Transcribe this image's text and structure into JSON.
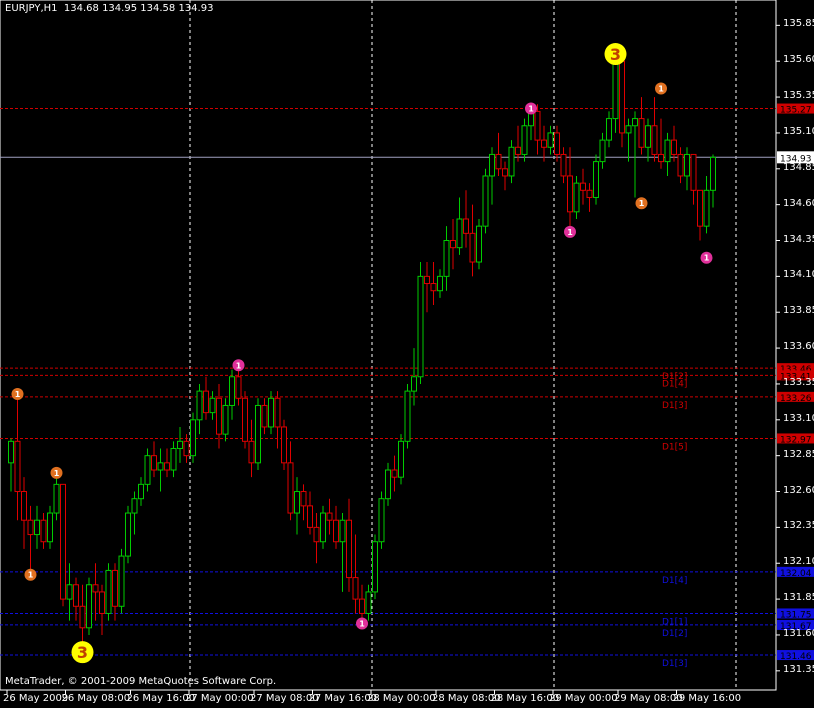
{
  "header": {
    "symbol": "EURJPY,H1",
    "open": "134.68",
    "high": "134.95",
    "low": "134.58",
    "close": "134.93"
  },
  "copyright": "MetaTrader, © 2001-2009 MetaQuotes Software Corp.",
  "colors": {
    "background": "#000000",
    "bull_candle": "#00cc00",
    "bear_candle": "#e00000",
    "grid": "#ffffff",
    "resistance": "#d00000",
    "support": "#1010e0",
    "current_price_line": "#a0a0c0",
    "marker_magenta": "#e0309a",
    "marker_orange": "#e07020",
    "marker_yellow": "#ffff00"
  },
  "chart_data": {
    "type": "candlestick",
    "title": "EURJPY,H1",
    "ylim": [
      131.3,
      135.95
    ],
    "xlim": [
      0,
      115
    ],
    "y_ticks": [
      "135.85",
      "135.60",
      "135.35",
      "135.10",
      "134.85",
      "134.60",
      "134.35",
      "134.10",
      "133.85",
      "133.60",
      "133.35",
      "133.10",
      "132.85",
      "132.60",
      "132.35",
      "132.10",
      "131.85",
      "131.60",
      "131.35"
    ],
    "x_ticks": [
      {
        "i": 0,
        "label": "26 May 2009"
      },
      {
        "i": 9,
        "label": "26 May 08:00"
      },
      {
        "i": 19,
        "label": "26 May 16:00"
      },
      {
        "i": 28,
        "label": "27 May 00:00"
      },
      {
        "i": 38,
        "label": "27 May 08:00"
      },
      {
        "i": 47,
        "label": "27 May 16:00"
      },
      {
        "i": 56,
        "label": "28 May 00:00"
      },
      {
        "i": 66,
        "label": "28 May 08:00"
      },
      {
        "i": 75,
        "label": "28 May 16:00"
      },
      {
        "i": 84,
        "label": "29 May 00:00"
      },
      {
        "i": 94,
        "label": "29 May 08:00"
      },
      {
        "i": 103,
        "label": "29 May 16:00"
      }
    ],
    "vertical_separators": [
      28,
      56,
      84,
      112
    ],
    "current_price": {
      "value": 134.93,
      "label": "134.93"
    },
    "price_tags": [
      {
        "value": 135.27,
        "label": "135.27",
        "style": "red"
      },
      {
        "value": 133.46,
        "label": "133.46",
        "style": "red"
      },
      {
        "value": 133.41,
        "label": "133.41",
        "style": "red"
      },
      {
        "value": 133.26,
        "label": "133.26",
        "style": "red"
      },
      {
        "value": 132.97,
        "label": "132.97",
        "style": "red"
      },
      {
        "value": 132.04,
        "label": "132.04",
        "style": "blue"
      },
      {
        "value": 131.75,
        "label": "131.75",
        "style": "blue"
      },
      {
        "value": 131.67,
        "label": "131.67",
        "style": "blue"
      },
      {
        "value": 131.46,
        "label": "131.46",
        "style": "blue"
      }
    ],
    "levels": [
      {
        "value": 135.27,
        "label": "",
        "style": "red"
      },
      {
        "value": 133.46,
        "label": "D1[2]",
        "style": "red"
      },
      {
        "value": 133.41,
        "label": "D1[4]",
        "style": "red"
      },
      {
        "value": 133.26,
        "label": "D1[3]",
        "style": "red"
      },
      {
        "value": 132.97,
        "label": "D1[5]",
        "style": "red"
      },
      {
        "value": 132.04,
        "label": "D1[4]",
        "style": "blue"
      },
      {
        "value": 131.75,
        "label": "D1[1]",
        "style": "blue"
      },
      {
        "value": 131.67,
        "label": "D1[2]",
        "style": "blue"
      },
      {
        "value": 131.46,
        "label": "D1[3]",
        "style": "blue"
      }
    ],
    "series": [
      {
        "name": "EURJPY,H1",
        "candles": [
          [
            132.8,
            132.97,
            132.6,
            132.95
          ],
          [
            132.95,
            133.25,
            132.4,
            132.6
          ],
          [
            132.6,
            132.7,
            132.2,
            132.4
          ],
          [
            132.4,
            132.5,
            132.0,
            132.3
          ],
          [
            132.3,
            132.5,
            132.2,
            132.4
          ],
          [
            132.4,
            132.45,
            132.2,
            132.25
          ],
          [
            132.25,
            132.5,
            132.2,
            132.45
          ],
          [
            132.45,
            132.7,
            132.4,
            132.65
          ],
          [
            132.65,
            132.65,
            131.8,
            131.85
          ],
          [
            131.85,
            132.1,
            131.7,
            131.95
          ],
          [
            131.95,
            132.0,
            131.7,
            131.8
          ],
          [
            131.8,
            131.95,
            131.5,
            131.65
          ],
          [
            131.65,
            132.0,
            131.6,
            131.95
          ],
          [
            131.95,
            132.1,
            131.7,
            131.9
          ],
          [
            131.9,
            131.95,
            131.6,
            131.75
          ],
          [
            131.75,
            132.1,
            131.7,
            132.05
          ],
          [
            132.05,
            132.1,
            131.7,
            131.8
          ],
          [
            131.8,
            132.2,
            131.75,
            132.15
          ],
          [
            132.15,
            132.5,
            132.1,
            132.45
          ],
          [
            132.45,
            132.6,
            132.3,
            132.55
          ],
          [
            132.55,
            132.7,
            132.5,
            132.65
          ],
          [
            132.65,
            132.9,
            132.6,
            132.85
          ],
          [
            132.85,
            132.95,
            132.7,
            132.75
          ],
          [
            132.75,
            132.9,
            132.6,
            132.8
          ],
          [
            132.8,
            132.9,
            132.7,
            132.75
          ],
          [
            132.75,
            132.95,
            132.7,
            132.9
          ],
          [
            132.9,
            133.05,
            132.8,
            132.95
          ],
          [
            132.95,
            133.0,
            132.8,
            132.85
          ],
          [
            132.85,
            133.15,
            132.8,
            133.1
          ],
          [
            133.1,
            133.35,
            133.0,
            133.3
          ],
          [
            133.3,
            133.4,
            133.1,
            133.15
          ],
          [
            133.15,
            133.3,
            133.1,
            133.25
          ],
          [
            133.25,
            133.35,
            132.9,
            133.0
          ],
          [
            133.0,
            133.25,
            132.95,
            133.2
          ],
          [
            133.2,
            133.45,
            133.1,
            133.4
          ],
          [
            133.4,
            133.5,
            133.2,
            133.25
          ],
          [
            133.25,
            133.3,
            132.9,
            132.95
          ],
          [
            132.95,
            133.1,
            132.7,
            132.8
          ],
          [
            132.8,
            133.25,
            132.75,
            133.2
          ],
          [
            133.2,
            133.25,
            133.0,
            133.05
          ],
          [
            133.05,
            133.3,
            133.0,
            133.25
          ],
          [
            133.25,
            133.3,
            132.9,
            133.05
          ],
          [
            133.05,
            133.1,
            132.75,
            132.8
          ],
          [
            132.8,
            132.95,
            132.4,
            132.45
          ],
          [
            132.45,
            132.7,
            132.3,
            132.6
          ],
          [
            132.6,
            132.65,
            132.4,
            132.5
          ],
          [
            132.5,
            132.6,
            132.3,
            132.35
          ],
          [
            132.35,
            132.45,
            132.1,
            132.25
          ],
          [
            132.25,
            132.5,
            132.2,
            132.45
          ],
          [
            132.45,
            132.55,
            132.3,
            132.4
          ],
          [
            132.4,
            132.5,
            132.2,
            132.25
          ],
          [
            132.25,
            132.45,
            131.9,
            132.4
          ],
          [
            132.4,
            132.55,
            131.9,
            132.0
          ],
          [
            132.0,
            132.3,
            131.75,
            131.85
          ],
          [
            131.85,
            131.95,
            131.7,
            131.75
          ],
          [
            131.75,
            131.95,
            131.7,
            131.9
          ],
          [
            131.9,
            132.3,
            131.85,
            132.25
          ],
          [
            132.25,
            132.6,
            132.2,
            132.55
          ],
          [
            132.55,
            132.8,
            132.5,
            132.75
          ],
          [
            132.75,
            132.85,
            132.6,
            132.7
          ],
          [
            132.7,
            133.0,
            132.65,
            132.95
          ],
          [
            132.95,
            133.35,
            132.9,
            133.3
          ],
          [
            133.3,
            133.6,
            133.2,
            133.4
          ],
          [
            133.4,
            134.2,
            133.35,
            134.1
          ],
          [
            134.1,
            134.2,
            133.85,
            134.05
          ],
          [
            134.05,
            134.2,
            133.9,
            134.0
          ],
          [
            134.0,
            134.15,
            133.95,
            134.1
          ],
          [
            134.1,
            134.45,
            134.0,
            134.35
          ],
          [
            134.35,
            134.5,
            134.15,
            134.3
          ],
          [
            134.3,
            134.65,
            134.25,
            134.5
          ],
          [
            134.5,
            134.7,
            134.3,
            134.4
          ],
          [
            134.4,
            134.6,
            134.1,
            134.2
          ],
          [
            134.2,
            134.5,
            134.15,
            134.45
          ],
          [
            134.45,
            134.85,
            134.4,
            134.8
          ],
          [
            134.8,
            135.0,
            134.6,
            134.95
          ],
          [
            134.95,
            135.1,
            134.8,
            134.85
          ],
          [
            134.85,
            134.9,
            134.7,
            134.8
          ],
          [
            134.8,
            135.05,
            134.75,
            135.0
          ],
          [
            135.0,
            135.15,
            134.9,
            134.95
          ],
          [
            134.95,
            135.2,
            134.9,
            135.15
          ],
          [
            135.15,
            135.3,
            135.05,
            135.25
          ],
          [
            135.25,
            135.3,
            134.95,
            135.05
          ],
          [
            135.05,
            135.15,
            134.9,
            135.0
          ],
          [
            135.0,
            135.15,
            134.95,
            135.1
          ],
          [
            135.1,
            135.15,
            134.9,
            134.95
          ],
          [
            134.95,
            135.0,
            134.75,
            134.8
          ],
          [
            134.8,
            135.0,
            134.45,
            134.55
          ],
          [
            134.55,
            134.8,
            134.5,
            134.75
          ],
          [
            134.75,
            134.85,
            134.6,
            134.7
          ],
          [
            134.7,
            134.75,
            134.55,
            134.65
          ],
          [
            134.65,
            134.95,
            134.6,
            134.9
          ],
          [
            134.9,
            135.1,
            134.85,
            135.05
          ],
          [
            135.05,
            135.25,
            135.0,
            135.2
          ],
          [
            135.2,
            135.66,
            135.1,
            135.6
          ],
          [
            135.6,
            135.66,
            135.0,
            135.1
          ],
          [
            135.1,
            135.2,
            134.9,
            135.15
          ],
          [
            135.15,
            135.25,
            134.65,
            135.2
          ],
          [
            135.2,
            135.35,
            134.95,
            135.0
          ],
          [
            135.0,
            135.2,
            134.9,
            135.15
          ],
          [
            135.15,
            135.35,
            134.9,
            134.95
          ],
          [
            134.95,
            135.2,
            134.85,
            134.9
          ],
          [
            134.9,
            135.1,
            134.8,
            135.05
          ],
          [
            135.05,
            135.15,
            134.9,
            134.95
          ],
          [
            134.95,
            135.0,
            134.75,
            134.8
          ],
          [
            134.8,
            135.0,
            134.7,
            134.95
          ],
          [
            134.95,
            134.95,
            134.6,
            134.7
          ],
          [
            134.7,
            134.7,
            134.35,
            134.45
          ],
          [
            134.45,
            134.8,
            134.4,
            134.7
          ],
          [
            134.7,
            134.95,
            134.58,
            134.93
          ]
        ]
      }
    ],
    "markers": [
      {
        "i": 1,
        "value": 133.28,
        "text": "1",
        "color": "orange",
        "size": "small"
      },
      {
        "i": 3,
        "value": 132.02,
        "text": "1",
        "color": "orange",
        "size": "small"
      },
      {
        "i": 7,
        "value": 132.73,
        "text": "1",
        "color": "orange",
        "size": "small"
      },
      {
        "i": 11,
        "value": 131.48,
        "text": "3",
        "color": "yellow",
        "size": "big"
      },
      {
        "i": 35,
        "value": 133.48,
        "text": "1",
        "color": "magenta",
        "size": "small"
      },
      {
        "i": 54,
        "value": 131.68,
        "text": "1",
        "color": "magenta",
        "size": "small"
      },
      {
        "i": 80,
        "value": 135.27,
        "text": "1",
        "color": "magenta",
        "size": "small"
      },
      {
        "i": 86,
        "value": 134.41,
        "text": "1",
        "color": "magenta",
        "size": "small"
      },
      {
        "i": 93,
        "value": 135.65,
        "text": "3",
        "color": "yellow",
        "size": "big"
      },
      {
        "i": 97,
        "value": 134.61,
        "text": "1",
        "color": "orange",
        "size": "small"
      },
      {
        "i": 100,
        "value": 135.41,
        "text": "1",
        "color": "orange",
        "size": "small"
      },
      {
        "i": 107,
        "value": 134.23,
        "text": "1",
        "color": "magenta",
        "size": "small"
      }
    ]
  }
}
